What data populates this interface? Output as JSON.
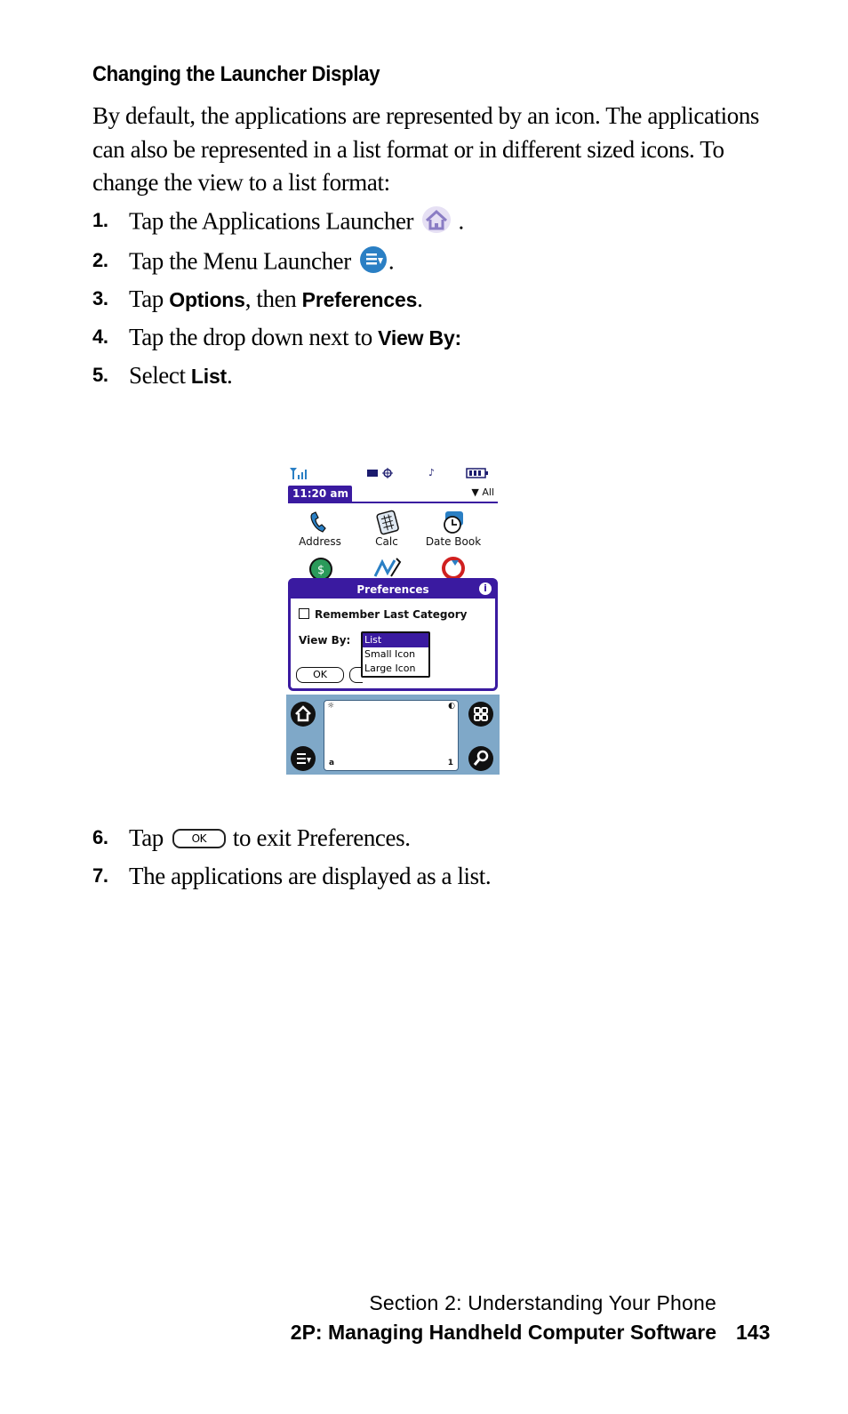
{
  "heading": "Changing the Launcher Display",
  "intro": "By default, the applications are represented by an icon. The applications can also be represented in a list format or in different sized icons. To change the view to a list format:",
  "steps": {
    "s1": {
      "num": "1.",
      "text": "Tap the Applications Launcher",
      "after": "."
    },
    "s2": {
      "num": "2.",
      "text": "Tap the Menu Launcher",
      "after": "."
    },
    "s3": {
      "num": "3.",
      "pre": "Tap ",
      "b1": "Options",
      "mid": ", then ",
      "b2": "Preferences",
      "after": "."
    },
    "s4": {
      "num": "4.",
      "pre": "Tap the drop down next to ",
      "b1": "View By:"
    },
    "s5": {
      "num": "5.",
      "pre": "Select ",
      "b1": "List",
      "after": "."
    },
    "s6": {
      "num": "6.",
      "pre": "Tap",
      "button": "OK",
      "after": "to exit Preferences."
    },
    "s7": {
      "num": "7.",
      "text": "The applications are displayed as a list."
    }
  },
  "screen": {
    "time": "11:20 am",
    "category": "All",
    "apps": [
      "Address",
      "Calc",
      "Date Book"
    ],
    "dialog": {
      "title": "Preferences",
      "info": "i",
      "checkbox_label": "Remember Last Category",
      "viewby_label": "View By:",
      "options": [
        "List",
        "Small Icon",
        "Large Icon"
      ],
      "ok": "OK"
    },
    "graffiti": {
      "left_top": "☼",
      "left_bottom": "a",
      "right_bottom": "1"
    }
  },
  "footer": {
    "section": "Section 2: Understanding Your Phone",
    "chapter": "2P: Managing Handheld Computer Software",
    "page": "143"
  },
  "colors": {
    "palm_accent": "#3a1aa0",
    "graffiti_bg": "#7fa8c8"
  }
}
